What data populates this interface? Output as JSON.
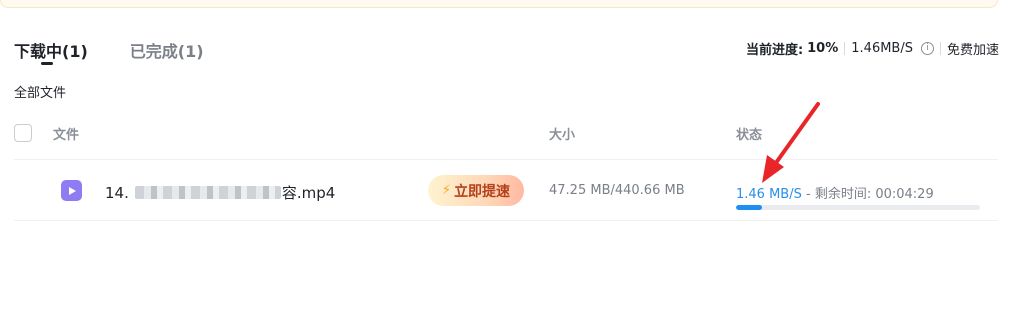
{
  "tabs": [
    {
      "label": "下载中(1)",
      "active": true
    },
    {
      "label": "已完成(1)",
      "active": false
    }
  ],
  "summary": {
    "label": "当前进度:",
    "percent": "10%",
    "speed": "1.46MB/S",
    "info_icon": "ⓘ",
    "boost_link": "免费加速"
  },
  "section_title": "全部文件",
  "table": {
    "headers": {
      "name": "文件",
      "size": "大小",
      "status": "状态"
    },
    "rows": [
      {
        "name_prefix": "14.",
        "name_suffix": "容.mp4",
        "file_type_icon": "video-file-icon",
        "boost_label": "立即提速",
        "size": "47.25 MB/440.66 MB",
        "speed": "1.46 MB/S",
        "remaining_text": " - 剩余时间: 00:04:29",
        "progress": 0.107
      }
    ]
  },
  "colors": {
    "accent_blue": "#1f8ef1",
    "annotation_red": "#e8262a",
    "file_icon_purple": "#8f7cf3"
  }
}
